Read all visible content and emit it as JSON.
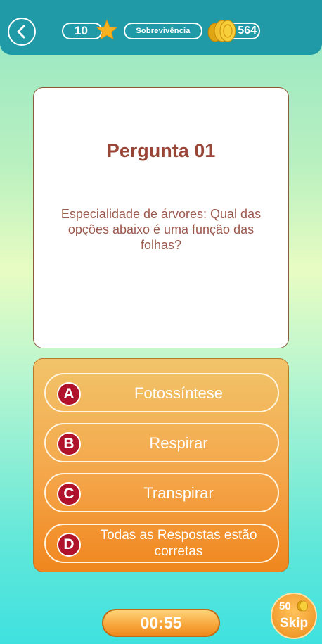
{
  "header": {
    "stars": "10",
    "mode": "Sobrevivência",
    "coins": "564"
  },
  "question": {
    "title": "Pergunta 01",
    "text": "Especialidade de árvores: Qual das opções abaixo é uma função das folhas?"
  },
  "answers": [
    {
      "letter": "A",
      "text": "Fotossíntese"
    },
    {
      "letter": "B",
      "text": "Respirar"
    },
    {
      "letter": "C",
      "text": "Transpirar"
    },
    {
      "letter": "D",
      "text": "Todas as Respostas estão corretas"
    }
  ],
  "timer": "00:55",
  "skip": {
    "cost": "50",
    "label": "Skip"
  },
  "colors": {
    "header_bg": "#1f9aa6",
    "title": "#9a4636",
    "badge": "#b0112b",
    "panel": "#f4a64a"
  },
  "icons": {
    "back": "chevron-left-icon",
    "star": "star-icon",
    "coins": "coin-stack-icon"
  }
}
